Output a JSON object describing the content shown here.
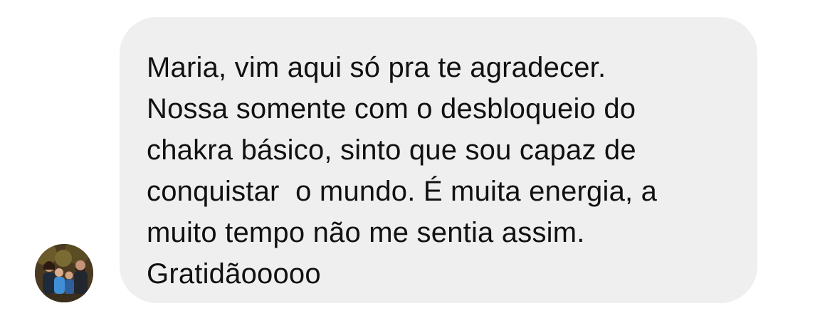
{
  "message": {
    "sender_avatar_icon": "family-photo-avatar",
    "bubble_color": "#efefef",
    "text": "Maria, vim aqui só pra te agradecer.\nNossa somente com o desbloqueio do\nchakra básico, sinto que sou capaz de\nconquistar  o mundo. É muita energia, a\nmuito tempo não me sentia assim.\nGratidãooooo"
  }
}
